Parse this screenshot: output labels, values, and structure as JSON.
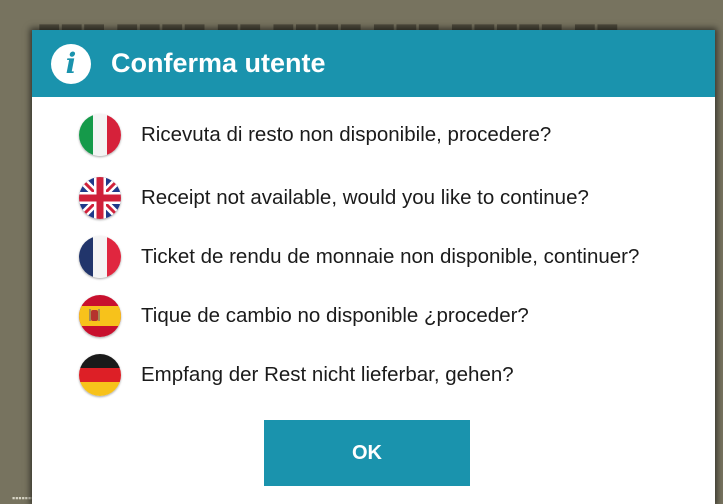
{
  "dialog": {
    "title": "Conferma utente",
    "icon": "info-icon",
    "messages": [
      {
        "lang": "italian",
        "flag": "flag-italy-icon",
        "text": "Ricevuta di resto non disponibile, procedere?"
      },
      {
        "lang": "english",
        "flag": "flag-uk-icon",
        "text": "Receipt not available, would you like to continue?"
      },
      {
        "lang": "french",
        "flag": "flag-france-icon",
        "text": "Ticket de rendu de monnaie non disponible, continuer?"
      },
      {
        "lang": "spanish",
        "flag": "flag-spain-icon",
        "text": "Tique de cambio no disponible ¿proceder?"
      },
      {
        "lang": "german",
        "flag": "flag-germany-icon",
        "text": "Empfang der Rest nicht lieferbar, gehen?"
      }
    ],
    "ok_label": "OK"
  },
  "colors": {
    "accent": "#1a93ad",
    "backdrop": "#77735f",
    "dialog_bg": "#ffffff",
    "text": "#1b1b1b"
  }
}
